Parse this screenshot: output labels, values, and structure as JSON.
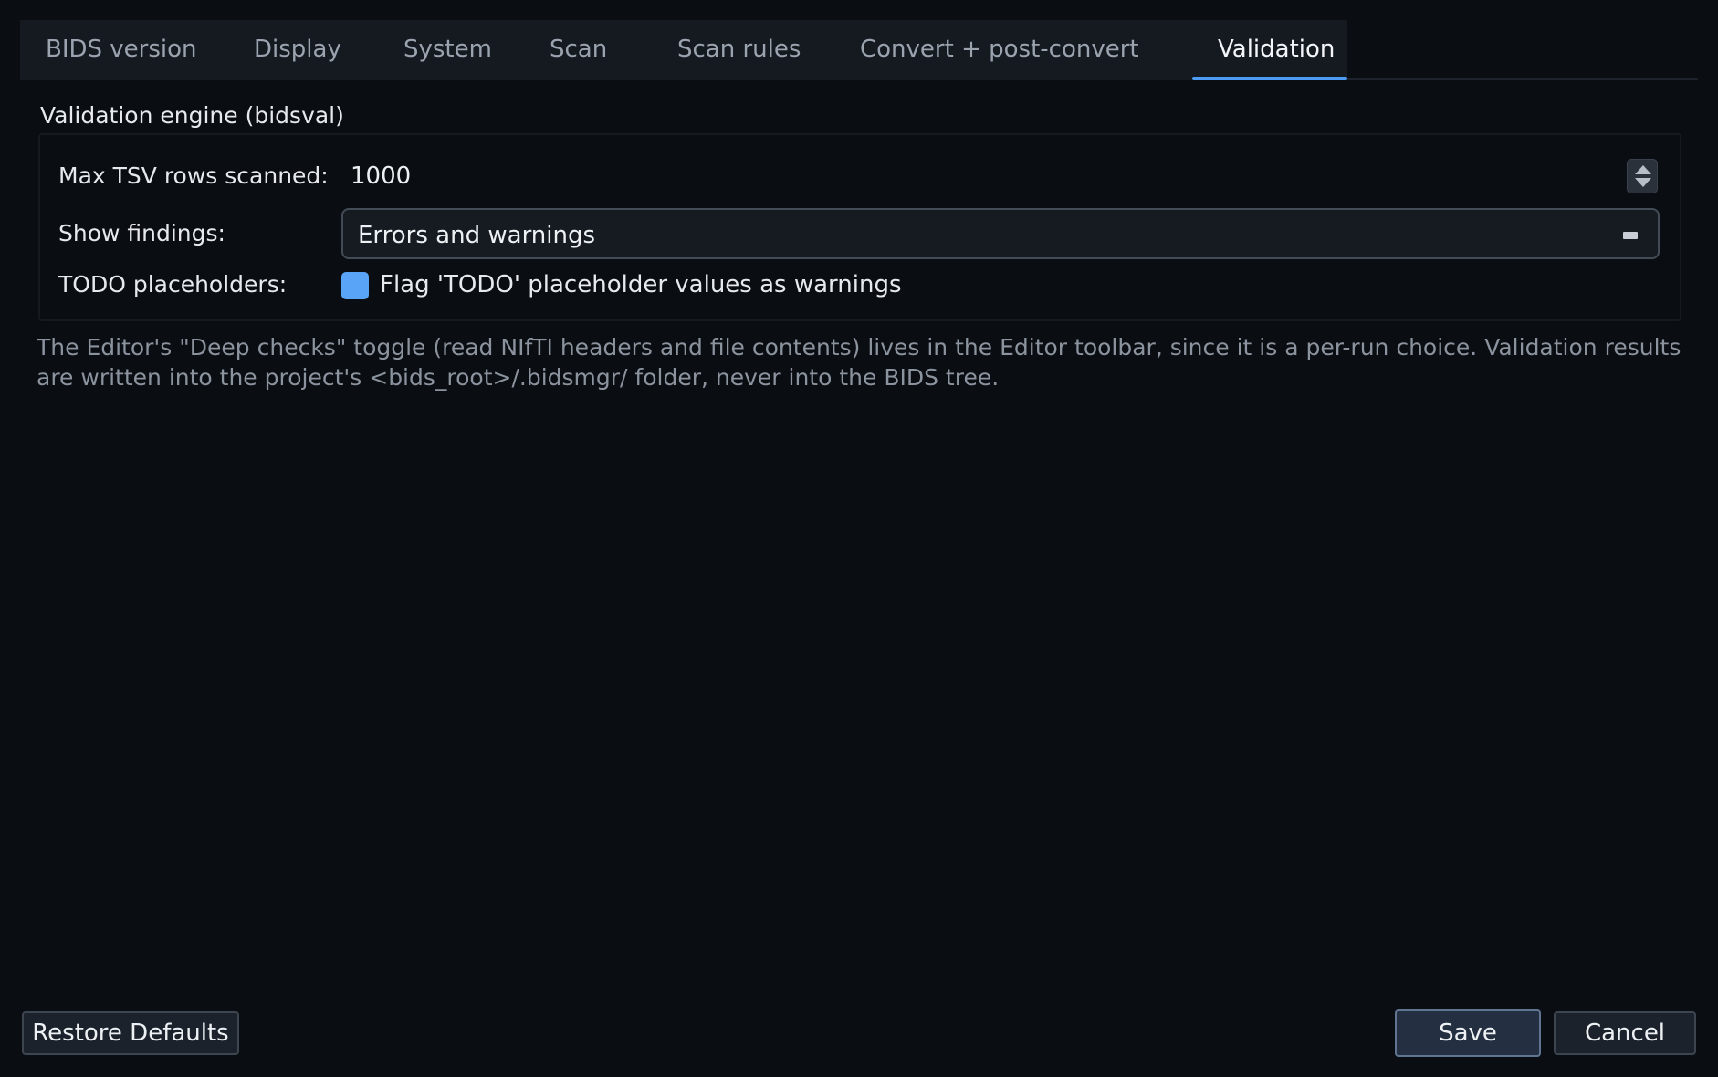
{
  "tabs": [
    {
      "label": "BIDS version"
    },
    {
      "label": "Display"
    },
    {
      "label": "System"
    },
    {
      "label": "Scan"
    },
    {
      "label": "Scan rules"
    },
    {
      "label": "Convert + post-convert"
    },
    {
      "label": "Validation",
      "active": true
    }
  ],
  "group": {
    "title": "Validation engine (bidsval)",
    "max_rows": {
      "label": "Max TSV rows scanned:",
      "value": "1000"
    },
    "findings": {
      "label": "Show findings:",
      "value": "Errors and warnings"
    },
    "todo": {
      "label": "TODO placeholders:",
      "checkbox_label": "Flag 'TODO' placeholder values as warnings",
      "checked": true
    }
  },
  "help_text": "The Editor's \"Deep checks\" toggle (read NIfTI headers and file contents) lives in the Editor toolbar, since it is a per-run choice. Validation results are written into the project's <bids_root>/.bidsmgr/ folder, never into the BIDS tree.",
  "buttons": {
    "restore": "Restore Defaults",
    "save": "Save",
    "cancel": "Cancel"
  },
  "colors": {
    "accent": "#4c9cf5",
    "checkbox": "#5aa4f7",
    "background": "#0a0d12"
  },
  "icons": {
    "spin": "spin-arrows-icon",
    "combo": "combo-dropdown-icon",
    "checkbox": "checkbox-checked-icon"
  }
}
